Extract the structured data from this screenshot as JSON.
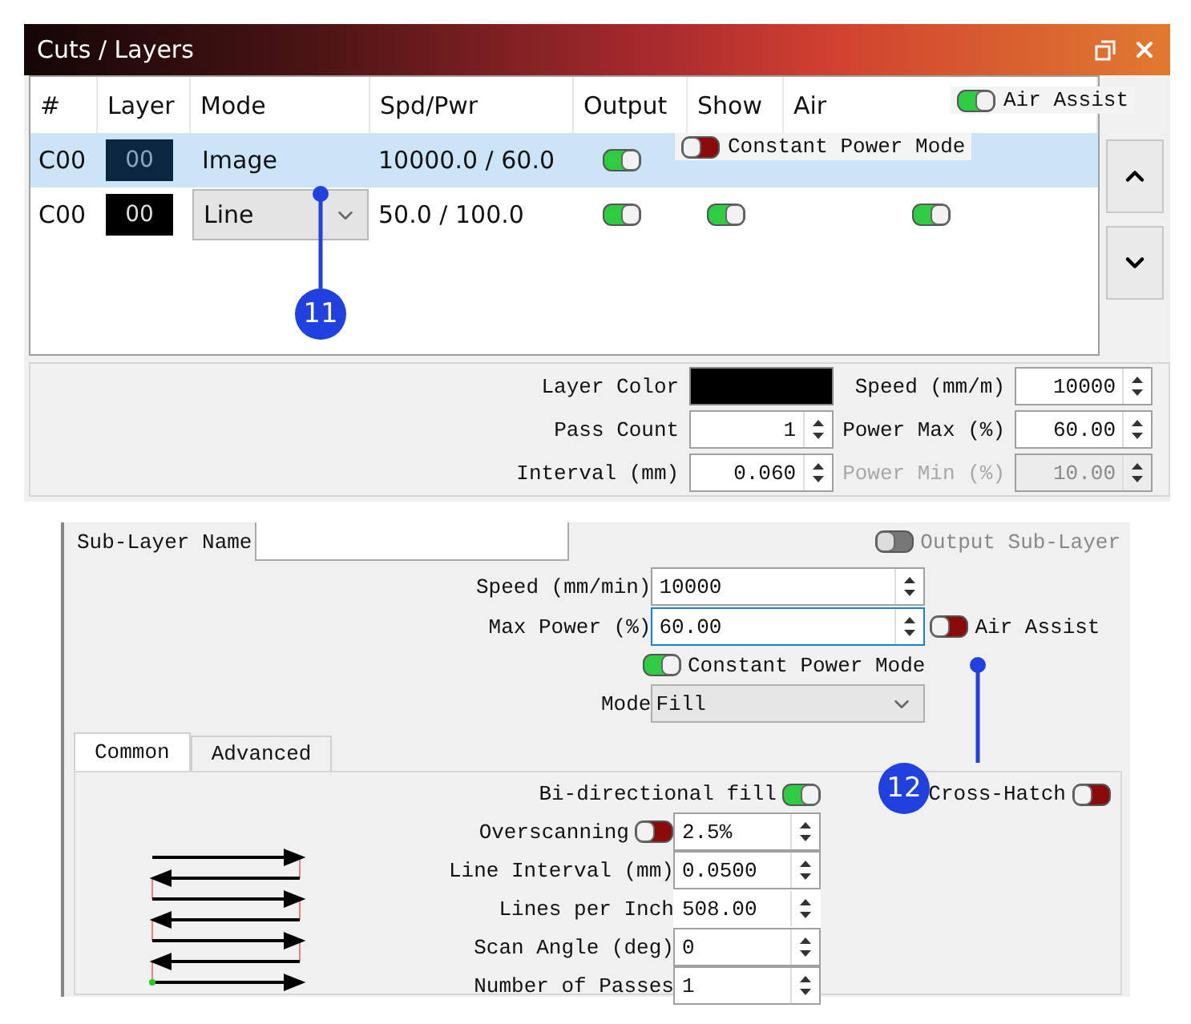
{
  "window": {
    "title": "Cuts / Layers"
  },
  "layers_table": {
    "columns": [
      "#",
      "Layer",
      "Mode",
      "Spd/Pwr",
      "Output",
      "Show",
      "Air"
    ],
    "rows": [
      {
        "number": "C00",
        "layer": "00",
        "mode": "Image",
        "kind": "text",
        "speed_power": "10000.0 / 60.0",
        "selected": true,
        "output": true
      },
      {
        "number": "C00",
        "layer": "00",
        "mode": "Line",
        "kind": "dropdown",
        "speed_power": "50.0 / 100.0",
        "selected": false,
        "output": true,
        "show": true,
        "air": true
      }
    ]
  },
  "air_assist_overlay": {
    "label": "Air Assist",
    "on": true
  },
  "power_mode_popup": {
    "label": "Constant Power Mode",
    "on": false
  },
  "layer_settings": [
    {
      "label": "Layer Color",
      "kind": "color",
      "color": "#000000",
      "disabled": false
    },
    {
      "label": "Speed (mm/m)",
      "kind": "spin",
      "value": "10000",
      "disabled": false
    },
    {
      "label": "Pass Count",
      "kind": "spin",
      "value": "1",
      "disabled": false
    },
    {
      "label": "Power Max (%)",
      "kind": "spin",
      "value": "60.00",
      "disabled": false
    },
    {
      "label": "Interval (mm)",
      "kind": "spin",
      "value": "0.060",
      "disabled": false
    },
    {
      "label": "Power Min (%)",
      "kind": "spin",
      "value": "10.00",
      "disabled": true
    }
  ],
  "sub_layer": {
    "name_label": "Sub-Layer Name",
    "output_toggle": {
      "label": "Output Sub-Layer",
      "on": false,
      "disabled": true
    },
    "speed": {
      "label": "Speed (mm/min)",
      "value": "10000",
      "focused": false
    },
    "max_power": {
      "label": "Max Power (%)",
      "value": "60.00",
      "focused": true
    },
    "air_assist": {
      "label": "Air Assist",
      "on": false
    },
    "constant_power": {
      "label": "Constant Power Mode",
      "on": true
    },
    "mode": {
      "label": "Mode",
      "value": "Fill"
    },
    "tabs": [
      {
        "label": "Common",
        "selected": true
      },
      {
        "label": "Advanced",
        "selected": false
      }
    ],
    "bidirectional": {
      "label": "Bi-directional fill",
      "on": true
    },
    "cross_hatch": {
      "label": "Cross-Hatch",
      "on": false
    },
    "fields": [
      {
        "label": "Overscanning",
        "kind": "toggle_spin",
        "on": false,
        "value": "2.5%"
      },
      {
        "label": "Line Interval (mm)",
        "kind": "spin",
        "value": "0.0500"
      },
      {
        "label": "Lines per Inch",
        "kind": "readonly",
        "value": "508.00"
      },
      {
        "label": "Scan Angle (deg)",
        "kind": "spin",
        "value": "0"
      },
      {
        "label": "Number of Passes",
        "kind": "spin",
        "value": "1"
      }
    ]
  },
  "callouts": [
    {
      "number": "11"
    },
    {
      "number": "12"
    }
  ]
}
